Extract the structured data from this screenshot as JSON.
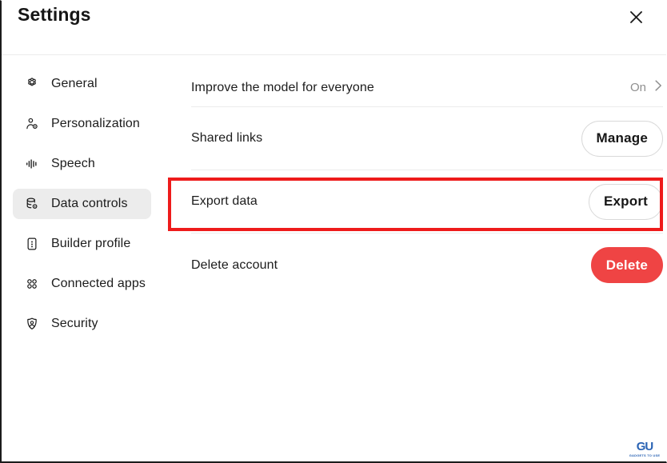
{
  "window": {
    "title": "Settings",
    "close_icon": "close-icon"
  },
  "sidebar": {
    "items": [
      {
        "label": "General",
        "icon": "gear-icon",
        "active": false
      },
      {
        "label": "Personalization",
        "icon": "person-spark-icon",
        "active": false
      },
      {
        "label": "Speech",
        "icon": "waveform-icon",
        "active": false
      },
      {
        "label": "Data controls",
        "icon": "database-gear-icon",
        "active": true
      },
      {
        "label": "Builder profile",
        "icon": "id-card-icon",
        "active": false
      },
      {
        "label": "Connected apps",
        "icon": "grid-apps-icon",
        "active": false
      },
      {
        "label": "Security",
        "icon": "shield-person-icon",
        "active": false
      }
    ]
  },
  "main": {
    "rows": [
      {
        "label": "Improve the model for everyone",
        "control": "value-chevron",
        "value": "On",
        "chevron_icon": "chevron-right-icon"
      },
      {
        "label": "Shared links",
        "control": "button",
        "button_label": "Manage",
        "button_style": "outline"
      },
      {
        "label": "Export data",
        "control": "button",
        "button_label": "Export",
        "button_style": "outline"
      },
      {
        "label": "Delete account",
        "control": "button",
        "button_label": "Delete",
        "button_style": "danger"
      }
    ]
  },
  "annotation": {
    "highlight_color": "#ee1b1b",
    "highlighted_row_label": "Export data"
  },
  "watermark": {
    "mark": "GU",
    "text": "GADGETS TO USE"
  },
  "colors": {
    "accent_danger": "#ef4444",
    "active_item_bg": "#ececec",
    "divider": "#ececec",
    "muted_text": "#8f8f8f",
    "annotation_red": "#ee1b1b",
    "watermark_blue": "#2a63b4"
  }
}
